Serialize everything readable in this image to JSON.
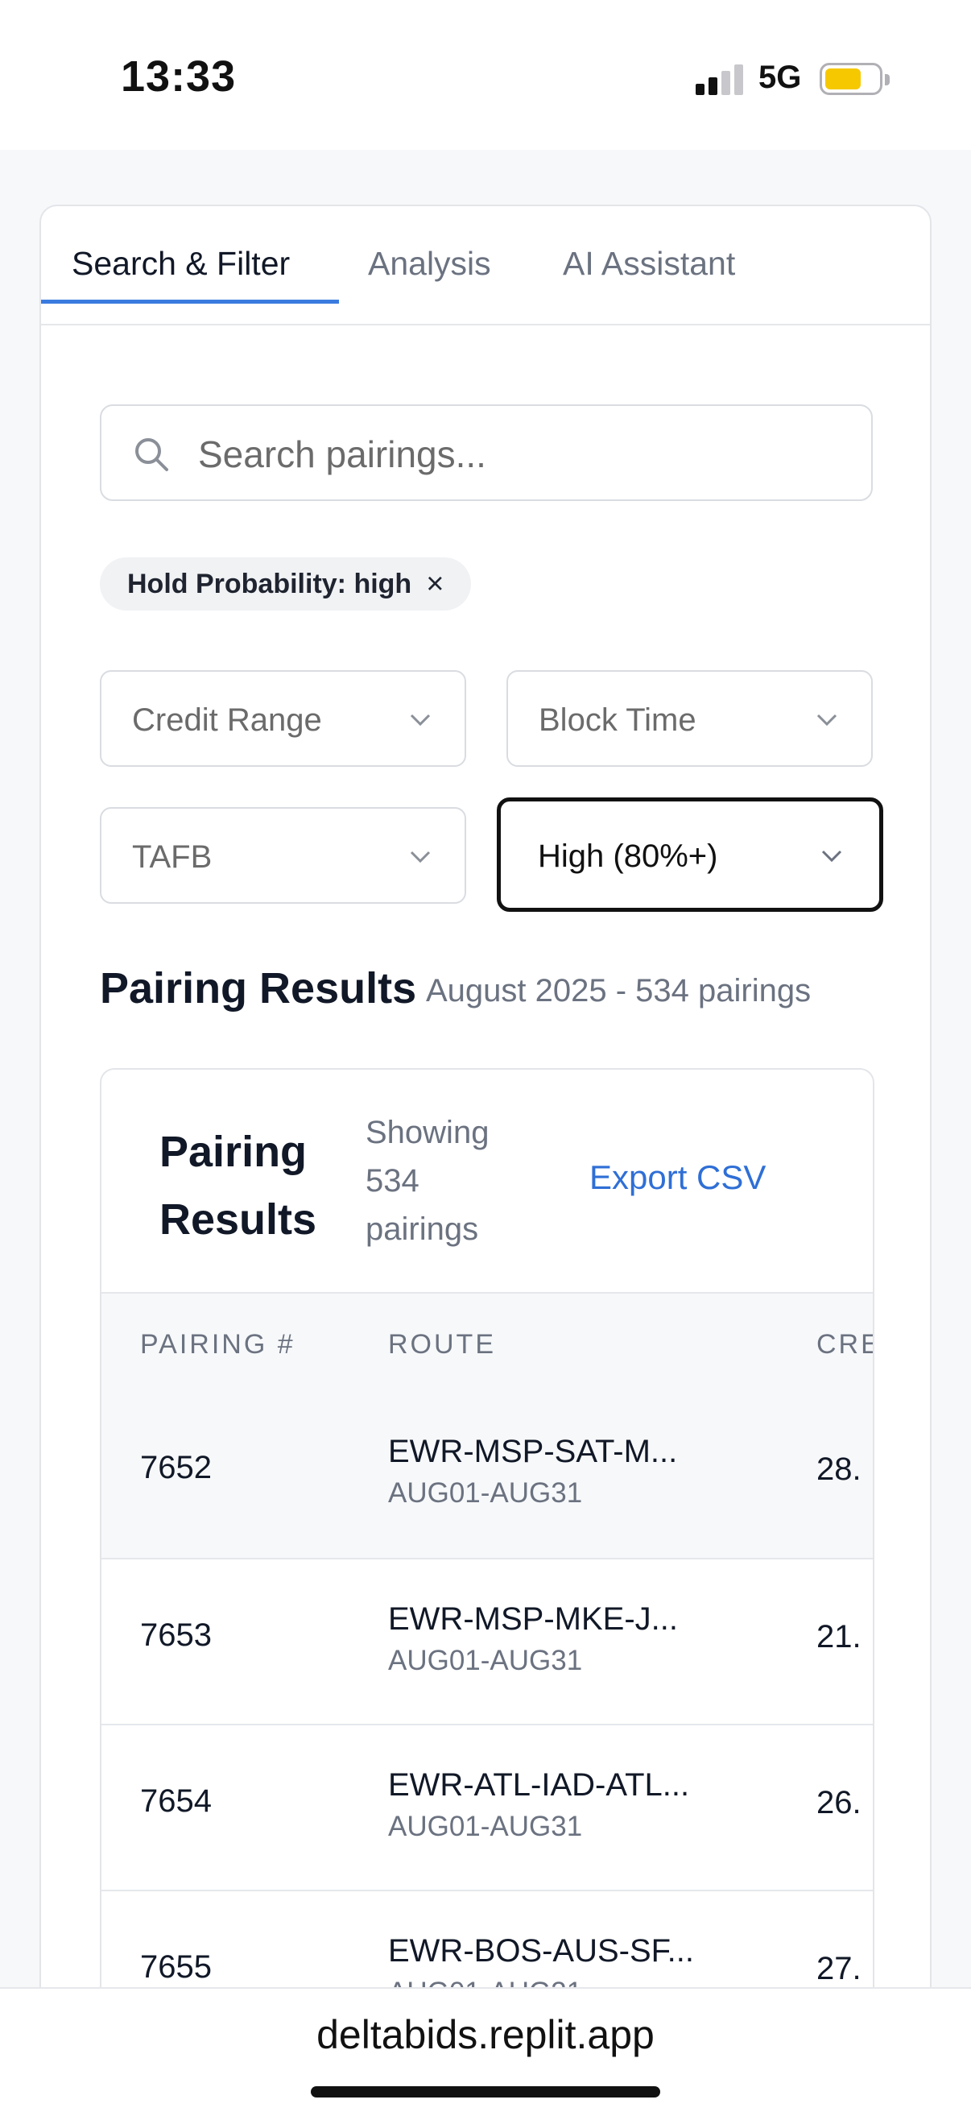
{
  "status_bar": {
    "time": "13:33",
    "network": "5G",
    "signal_bars_active": 2,
    "signal_bars_total": 4,
    "battery_level": 0.6,
    "battery_color": "#f6c800"
  },
  "tabs": [
    {
      "label": "Search & Filter",
      "active": true
    },
    {
      "label": "Analysis",
      "active": false
    },
    {
      "label": "AI Assistant",
      "active": false
    }
  ],
  "search": {
    "placeholder": "Search pairings...",
    "value": "",
    "icon": "search-icon"
  },
  "active_filter": {
    "label": "Hold Probability: high",
    "close_icon": "close-icon"
  },
  "filters": [
    {
      "label": "Credit Range",
      "selected": false
    },
    {
      "label": "Block Time",
      "selected": false
    },
    {
      "label": "TAFB",
      "selected": false
    },
    {
      "label": "High (80%+)",
      "selected": true
    }
  ],
  "results": {
    "heading": "Pairing Results",
    "subtitle": "August 2025 - 534 pairings"
  },
  "table_card": {
    "title": "Pairing Results",
    "showing": "Showing 534 pairings",
    "export_label": "Export CSV",
    "columns": [
      "PAIRING #",
      "ROUTE",
      "CRE"
    ],
    "rows": [
      {
        "number": "7652",
        "route": "EWR-MSP-SAT-M...",
        "dates": "AUG01-AUG31",
        "credit": "28."
      },
      {
        "number": "7653",
        "route": "EWR-MSP-MKE-J...",
        "dates": "AUG01-AUG31",
        "credit": "21."
      },
      {
        "number": "7654",
        "route": "EWR-ATL-IAD-ATL...",
        "dates": "AUG01-AUG31",
        "credit": "26."
      },
      {
        "number": "7655",
        "route": "EWR-BOS-AUS-SF...",
        "dates": "AUG01-AUG31",
        "credit": "27."
      }
    ]
  },
  "browser": {
    "url": "deltabids.replit.app"
  },
  "colors": {
    "accent": "#3b7be0",
    "link": "#2f6fd6",
    "text_primary": "#111827",
    "text_muted": "#6b7280"
  }
}
